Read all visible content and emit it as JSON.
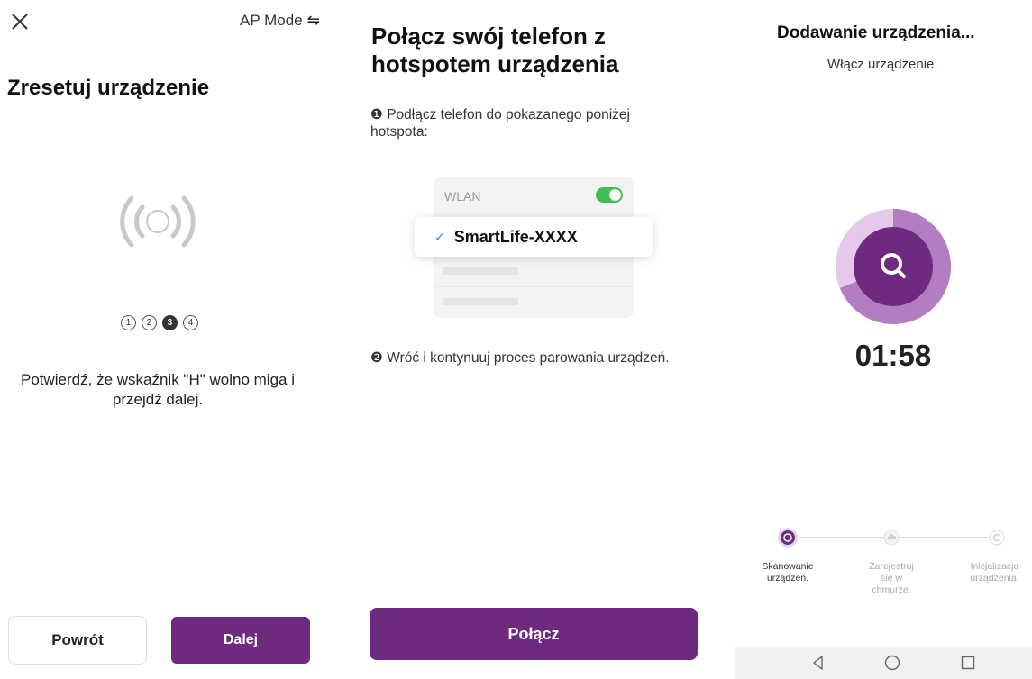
{
  "panel_reset": {
    "close_icon": "close-icon",
    "mode_label": "AP Mode",
    "mode_switch_glyph": "⇋",
    "title": "Zresetuj urządzenie",
    "steps": [
      "1",
      "2",
      "3",
      "4"
    ],
    "active_step": 3,
    "instruction": "Potwierdź, że wskaźnik \"H\" wolno miga i przejdź dalej.",
    "back_label": "Powrót",
    "next_label": "Dalej"
  },
  "panel_hotspot": {
    "title": "Połącz swój telefon z hotspotem urządzenia",
    "step1_marker": "❶",
    "step1_text": "Podłącz telefon do pokazanego poniżej hotspota:",
    "wlan_label": "WLAN",
    "wlan_on": true,
    "network_name": "SmartLife-XXXX",
    "step2_marker": "❷",
    "step2_text": "Wróć i kontynuuj proces parowania urządzeń.",
    "connect_label": "Połącz"
  },
  "panel_adding": {
    "title": "Dodawanie urządzenia...",
    "subtitle": "Włącz urządzenie.",
    "timer": "01:58",
    "progress_steps": [
      {
        "label": "Skanowanie urządzeń.",
        "icon": "scan-step-icon",
        "active": true
      },
      {
        "label": "Zarejestruj się w chmurze.",
        "icon": "cloud-step-icon",
        "active": false
      },
      {
        "label": "Inicjalizacja urządzenia.",
        "icon": "init-step-icon",
        "active": false
      }
    ]
  },
  "nav": {
    "back_icon": "nav-back-icon",
    "home_icon": "nav-home-icon",
    "recents_icon": "nav-recents-icon"
  },
  "colors": {
    "primary": "#6e2a7f",
    "toggle_on": "#3fbe55",
    "check": "#4a7fd4"
  }
}
